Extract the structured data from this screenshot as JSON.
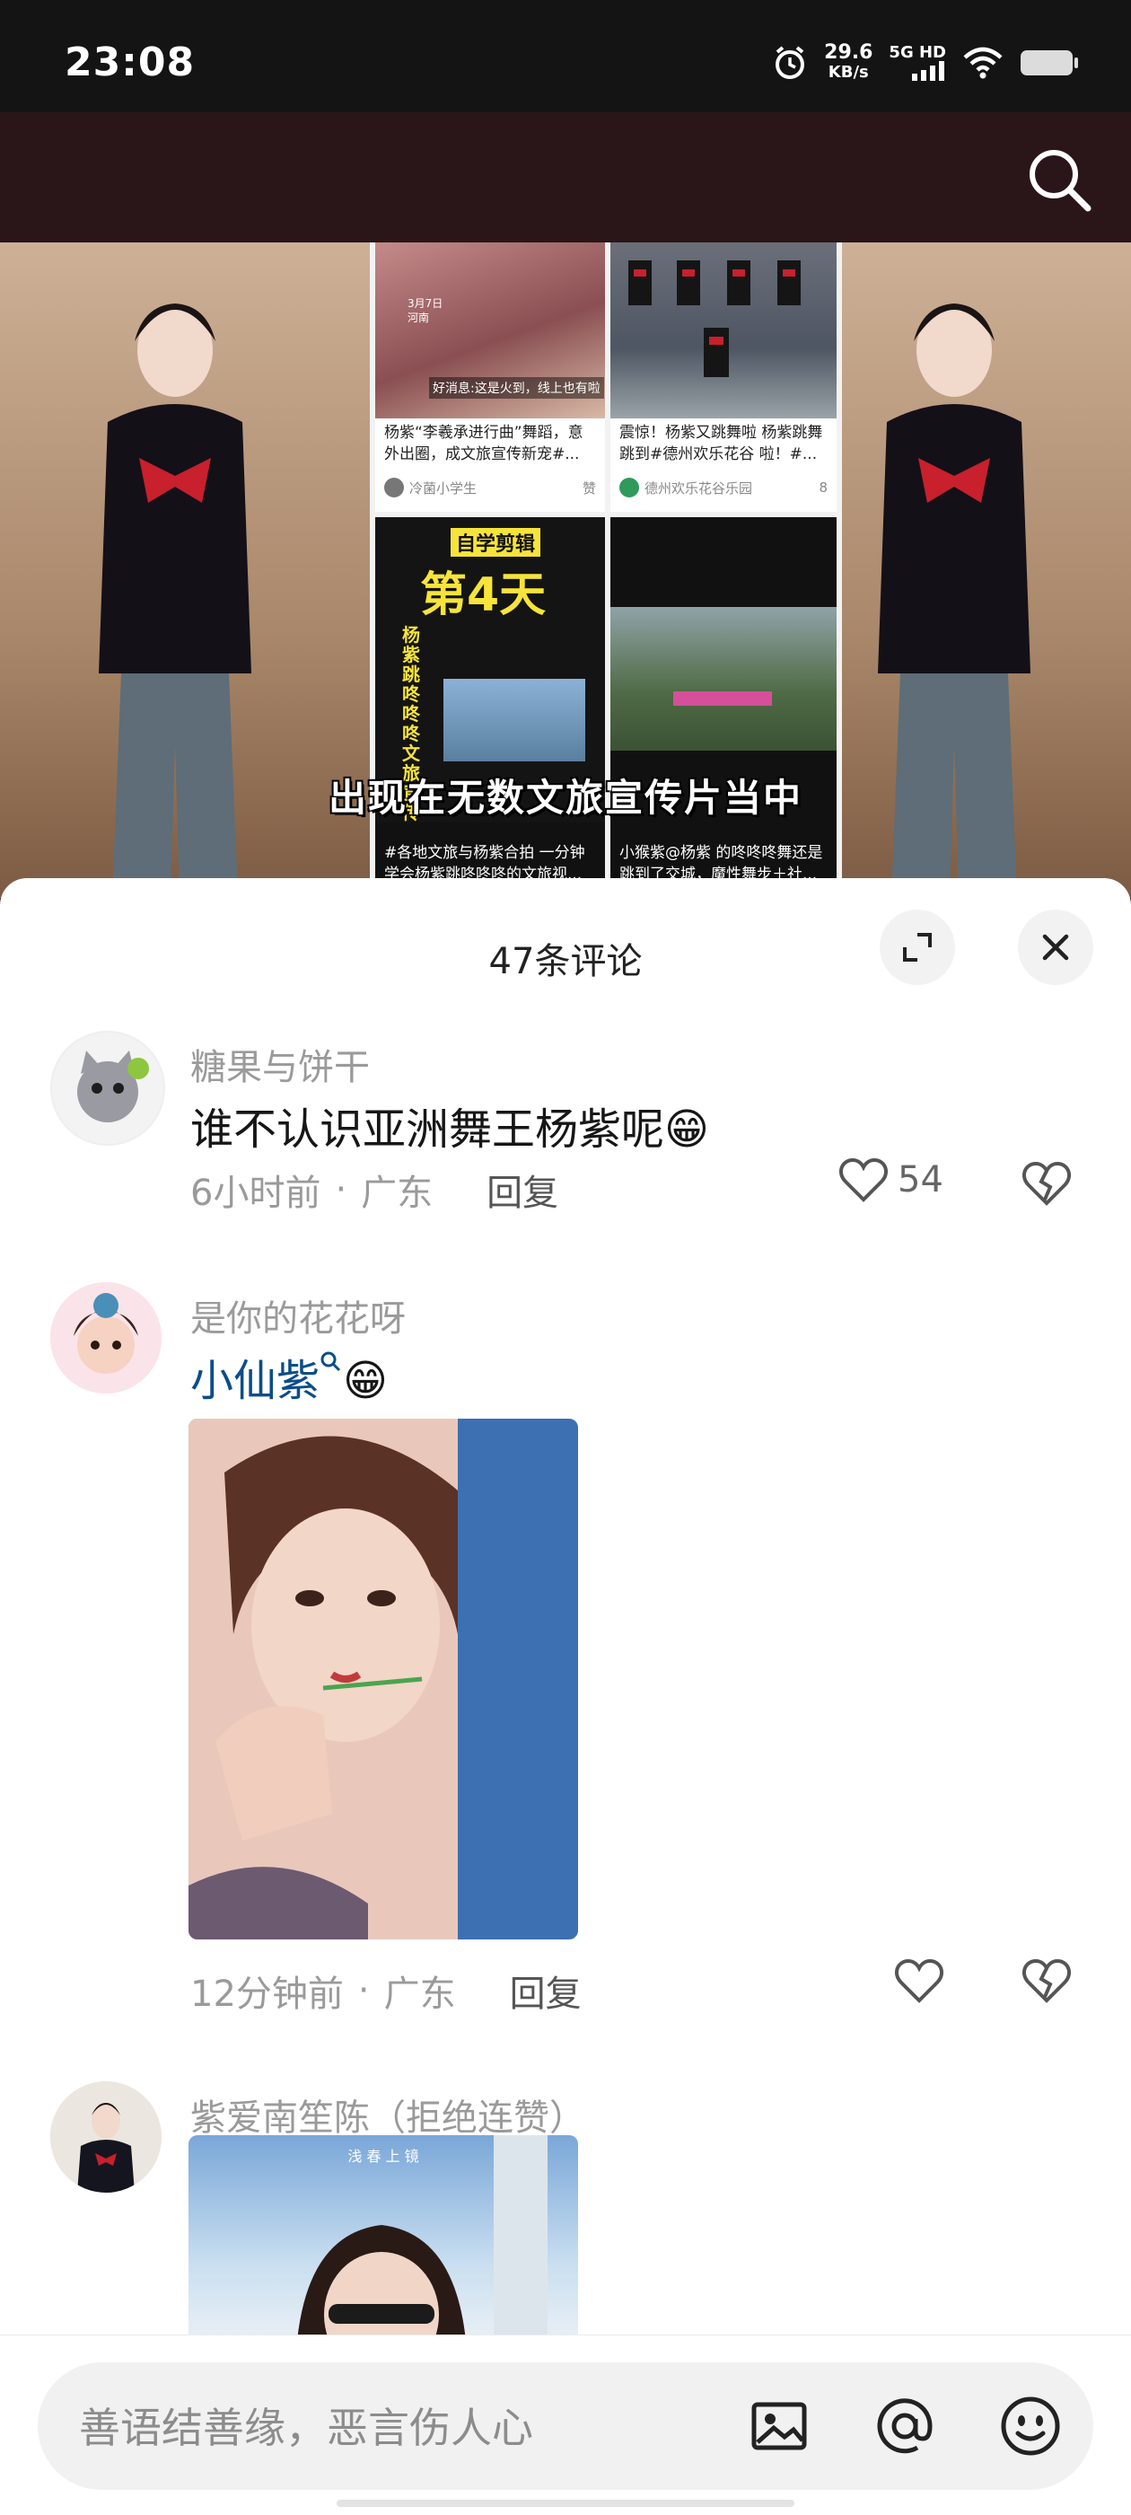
{
  "status_bar": {
    "time": "23:08",
    "speed_value": "29.6",
    "speed_unit": "KB/s",
    "network": "5G HD"
  },
  "video": {
    "caption": "出现在无数文旅宣传片当中",
    "cards": [
      {
        "badge": "3月7日 河南",
        "img_text": "好消息:这是火到，线上也有啦",
        "title": "杨紫“李羲承进行曲”舞蹈，意外出圈，成文旅宣传新宠#...",
        "author": "冷菌小学生",
        "likes": "赞"
      },
      {
        "title": "震惊！杨紫又跳舞啦 杨紫跳舞跳到#德州欢乐花谷 啦！#...",
        "author": "德州欢乐花谷乐园",
        "likes": "8"
      },
      {
        "img_top": "自学剪辑",
        "img_big": "第4天",
        "img_side": "杨紫跳咚咚咚文旅宣传",
        "title": "#各地文旅与杨紫合拍 一分钟学会杨紫跳咚咚咚的文旅视..."
      },
      {
        "title": "小猴紫@杨紫 的咚咚咚舞还是跳到了交城，魔性舞步＋社..."
      }
    ]
  },
  "sheet": {
    "title": "47条评论",
    "comments": [
      {
        "username": "糖果与饼干",
        "text": "谁不认识亚洲舞王杨紫呢",
        "emoji": "😁",
        "time": "6小时前",
        "location": "广东",
        "reply": "回复",
        "likes": "54"
      },
      {
        "username": "是你的花花呀",
        "text": "小仙紫",
        "emoji": "😁",
        "time": "12分钟前",
        "location": "广东",
        "reply": "回复",
        "likes": ""
      },
      {
        "username": "紫爱南笙陈（拒绝连赞）",
        "image_caption": "浅 春 上 镜"
      }
    ],
    "separator": "·"
  },
  "input": {
    "placeholder": "善语结善缘，恶言伤人心"
  },
  "icons": {
    "search": "search-icon",
    "expand": "expand-icon",
    "close": "close-icon",
    "like": "heart-icon",
    "dislike": "broken-heart-icon",
    "image": "image-icon",
    "mention": "at-icon",
    "emoji": "emoji-icon"
  }
}
